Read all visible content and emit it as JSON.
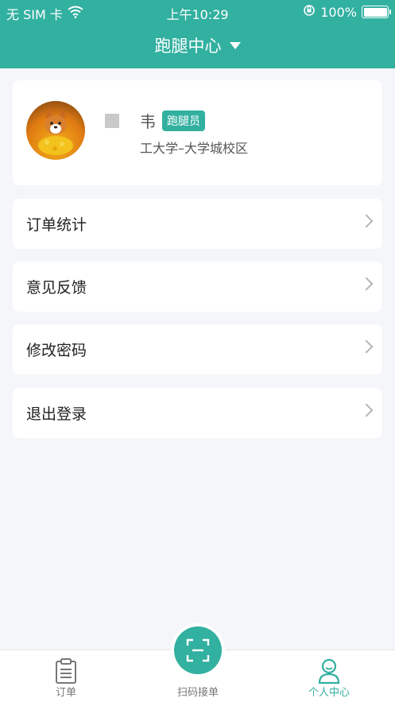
{
  "status_bar": {
    "carrier": "无 SIM 卡",
    "time": "上午10:29",
    "battery": "100%"
  },
  "header": {
    "title": "跑腿中心"
  },
  "profile": {
    "name": "韦",
    "role_badge": "跑腿员",
    "school": "工大学–大学城校区"
  },
  "menu": [
    {
      "label": "订单统计"
    },
    {
      "label": "意见反馈"
    },
    {
      "label": "修改密码"
    },
    {
      "label": "退出登录"
    }
  ],
  "tabbar": {
    "orders": "订单",
    "scan": "扫码接单",
    "profile": "个人中心",
    "active": "profile"
  },
  "colors": {
    "accent": "#32b0a0",
    "background": "#f5f6fa"
  }
}
